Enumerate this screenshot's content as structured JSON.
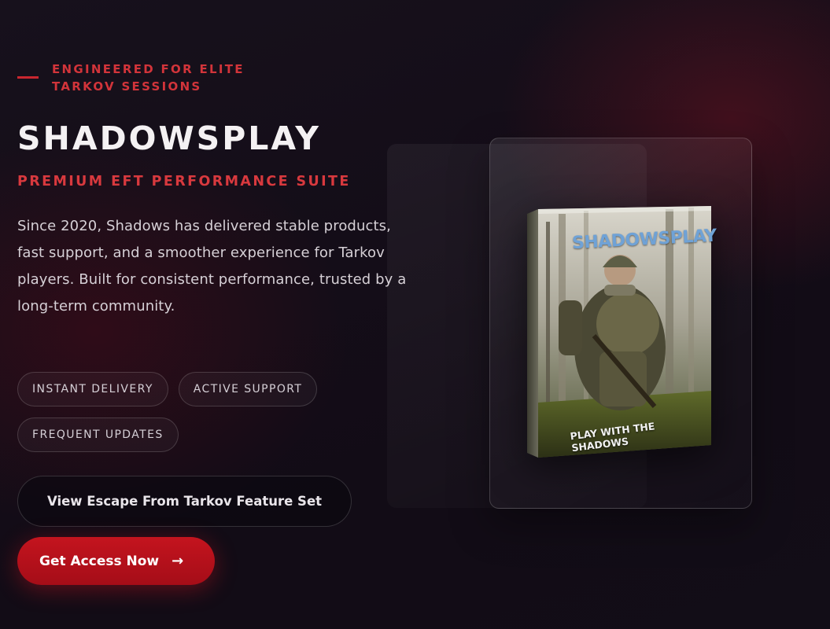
{
  "hero": {
    "eyebrow": "ENGINEERED FOR ELITE TARKOV SESSIONS",
    "title": "SHADOWSPLAY",
    "subtitle": "PREMIUM EFT PERFORMANCE SUITE",
    "description": "Since 2020, Shadows has delivered stable products, fast support, and a smoother experience for Tarkov players. Built for consistent performance, trusted by a long-term community.",
    "tags": [
      "INSTANT DELIVERY",
      "ACTIVE SUPPORT",
      "FREQUENT UPDATES"
    ],
    "feature_button": "View Escape From Tarkov Feature Set",
    "cta_button": "Get Access Now",
    "cta_icon": "arrow-right-icon"
  },
  "product": {
    "box_brand": "SHADOWSPLAY",
    "box_tagline": "PLAY WITH THE SHADOWS"
  },
  "colors": {
    "accent": "#d2343a",
    "cta": "#c4141e",
    "background": "#140d18"
  }
}
